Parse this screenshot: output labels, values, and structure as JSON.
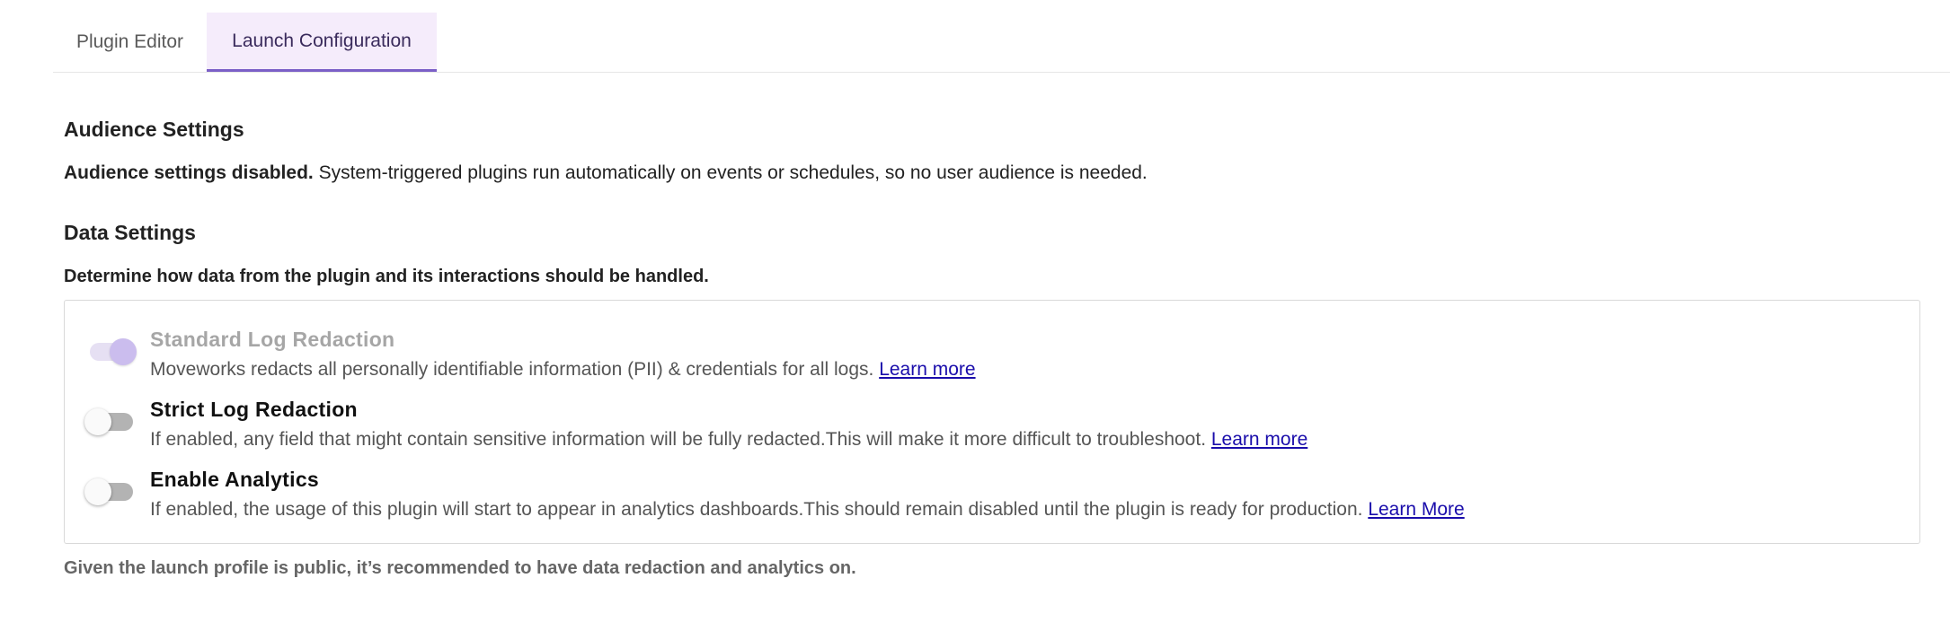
{
  "tabs": [
    {
      "label": "Plugin Editor"
    },
    {
      "label": "Launch Configuration"
    }
  ],
  "audience": {
    "title": "Audience Settings",
    "bold_text": "Audience settings disabled.",
    "text": " System-triggered plugins run automatically on events or schedules, so no user audience is needed."
  },
  "data_settings": {
    "title": "Data Settings",
    "subtitle": "Determine how data from the plugin and its interactions should be handled.",
    "items": [
      {
        "title": "Standard Log Redaction",
        "description": "Moveworks redacts all personally identifiable information (PII) & credentials for all logs. ",
        "link": "Learn more",
        "state": "on",
        "disabled": true
      },
      {
        "title": "Strict Log Redaction",
        "description": "If enabled, any field that might contain sensitive information will be fully redacted.This will make it more difficult to troubleshoot. ",
        "link": "Learn more",
        "state": "off",
        "disabled": false
      },
      {
        "title": "Enable Analytics",
        "description": "If enabled, the usage of this plugin will start to appear in analytics dashboards.This should remain disabled until the plugin is ready for production. ",
        "link": "Learn More",
        "state": "off",
        "disabled": false
      }
    ],
    "footer": "Given the launch profile is public, it’s recommended to have data redaction and analytics on."
  },
  "colors": {
    "accent": "#7b5fc7",
    "active_tab_bg": "#f5ecfb",
    "link": "#1a0dab"
  }
}
